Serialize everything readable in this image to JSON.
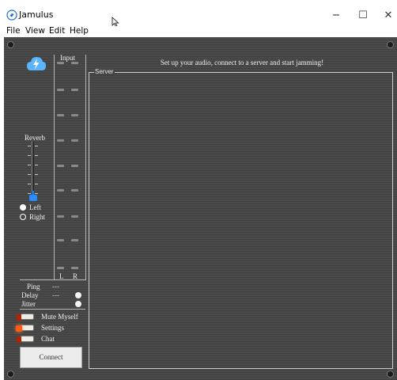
{
  "window": {
    "title": "Jamulus",
    "min_glyph": "−",
    "max_glyph": "☐",
    "close_glyph": "✕"
  },
  "menu": {
    "items": [
      "File",
      "View",
      "Edit",
      "Help"
    ]
  },
  "mixer": {
    "input_label": "Input",
    "left_channel": "L",
    "right_channel": "R",
    "reverb_label": "Reverb",
    "reverb_channel_options": [
      "Left",
      "Right"
    ],
    "reverb_channel_selected": "Left"
  },
  "stats": {
    "ping_label": "Ping",
    "ping_value": "---",
    "delay_label": "Delay",
    "delay_value": "---",
    "jitter_label": "Jitter"
  },
  "toggles": {
    "mute_label": "Mute Myself",
    "settings_label": "Settings",
    "chat_label": "Chat"
  },
  "connect_label": "Connect",
  "header_message": "Set up your audio, connect to a server and start jamming!",
  "server_label": "Server",
  "colors": {
    "panel": "#454545",
    "accent_blue": "#1e78e6",
    "led_active": "#ff5a14",
    "led_inactive": "#b82000"
  }
}
